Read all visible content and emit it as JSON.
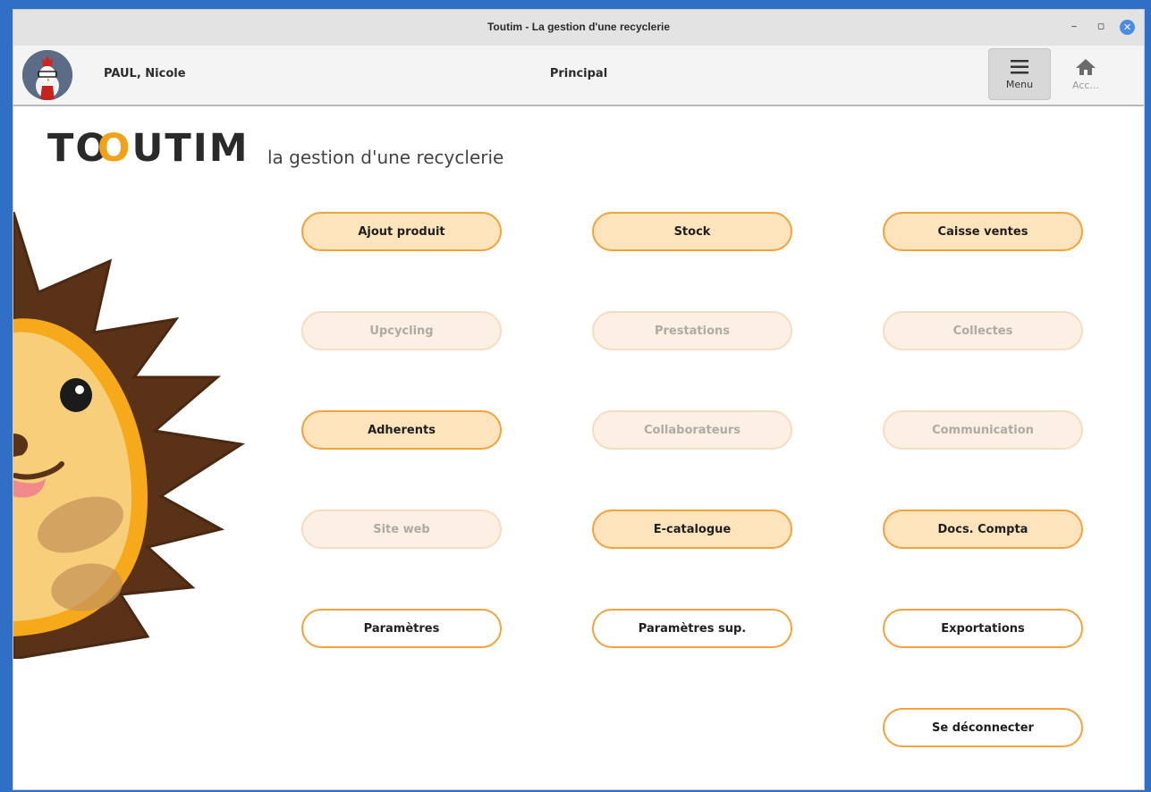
{
  "window": {
    "title": "Toutim - La gestion d'une recyclerie",
    "controls": {
      "minimize": "–",
      "maximize": "▫",
      "close": "✕"
    }
  },
  "header": {
    "user_name": "PAUL, Nicole",
    "page_title": "Principal",
    "menu_label": "Menu",
    "home_label": "Acc..."
  },
  "brand": {
    "logo_text": "TOOUTIM",
    "tagline": "la gestion d'une recyclerie",
    "accent_color": "#f0a21a"
  },
  "buttons": [
    {
      "label": "Ajout produit",
      "state": "enabled"
    },
    {
      "label": "Stock",
      "state": "enabled"
    },
    {
      "label": "Caisse ventes",
      "state": "enabled"
    },
    {
      "label": "Upcycling",
      "state": "disabled"
    },
    {
      "label": "Prestations",
      "state": "disabled"
    },
    {
      "label": "Collectes",
      "state": "disabled"
    },
    {
      "label": "Adherents",
      "state": "enabled"
    },
    {
      "label": "Collaborateurs",
      "state": "disabled"
    },
    {
      "label": "Communication",
      "state": "disabled"
    },
    {
      "label": "Site web",
      "state": "disabled"
    },
    {
      "label": "E-catalogue",
      "state": "enabled"
    },
    {
      "label": "Docs. Compta",
      "state": "enabled"
    },
    {
      "label": "Paramètres",
      "state": "enabled"
    },
    {
      "label": "Paramètres sup.",
      "state": "enabled"
    },
    {
      "label": "Exportations",
      "state": "enabled"
    },
    {
      "label": "Se déconnecter",
      "state": "enabled"
    }
  ]
}
